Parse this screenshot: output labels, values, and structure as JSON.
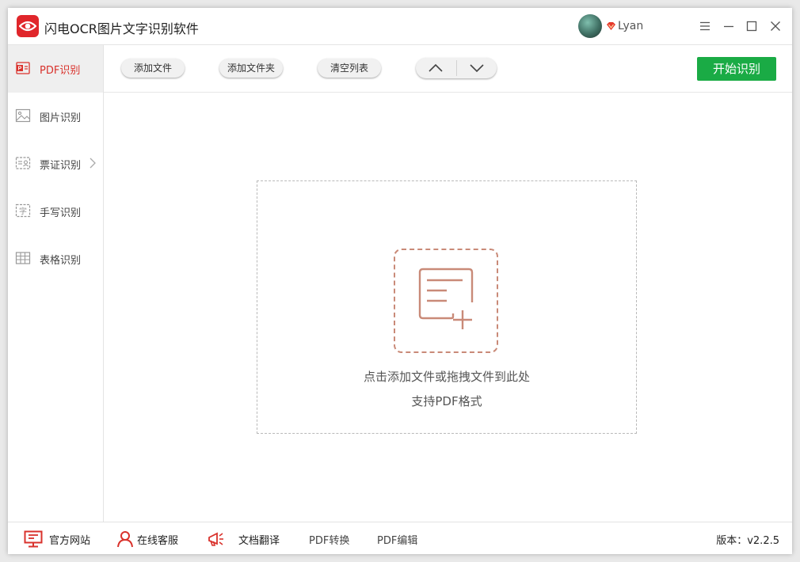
{
  "app": {
    "title": "闪电OCR图片文字识别软件"
  },
  "user": {
    "name": "Lyan"
  },
  "sidebar": {
    "items": [
      {
        "label": "PDF识别",
        "icon": "pdf-icon",
        "active": true
      },
      {
        "label": "图片识别",
        "icon": "image-icon"
      },
      {
        "label": "票证识别",
        "icon": "id-card-icon",
        "has_submenu": true
      },
      {
        "label": "手写识别",
        "icon": "handwriting-icon"
      },
      {
        "label": "表格识别",
        "icon": "table-icon"
      }
    ]
  },
  "toolbar": {
    "add_file": "添加文件",
    "add_folder": "添加文件夹",
    "clear_list": "清空列表",
    "start": "开始识别"
  },
  "dropzone": {
    "hint": "点击添加文件或拖拽文件到此处",
    "format": "支持PDF格式"
  },
  "footer": {
    "website": "官方网站",
    "support": "在线客服",
    "translate": "文档翻译",
    "pdf_convert": "PDF转换",
    "pdf_edit": "PDF编辑",
    "version": "版本：v2.2.5"
  },
  "colors": {
    "accent": "#d9322c",
    "start_button": "#1aab45",
    "doc_icon": "#c98a78"
  }
}
